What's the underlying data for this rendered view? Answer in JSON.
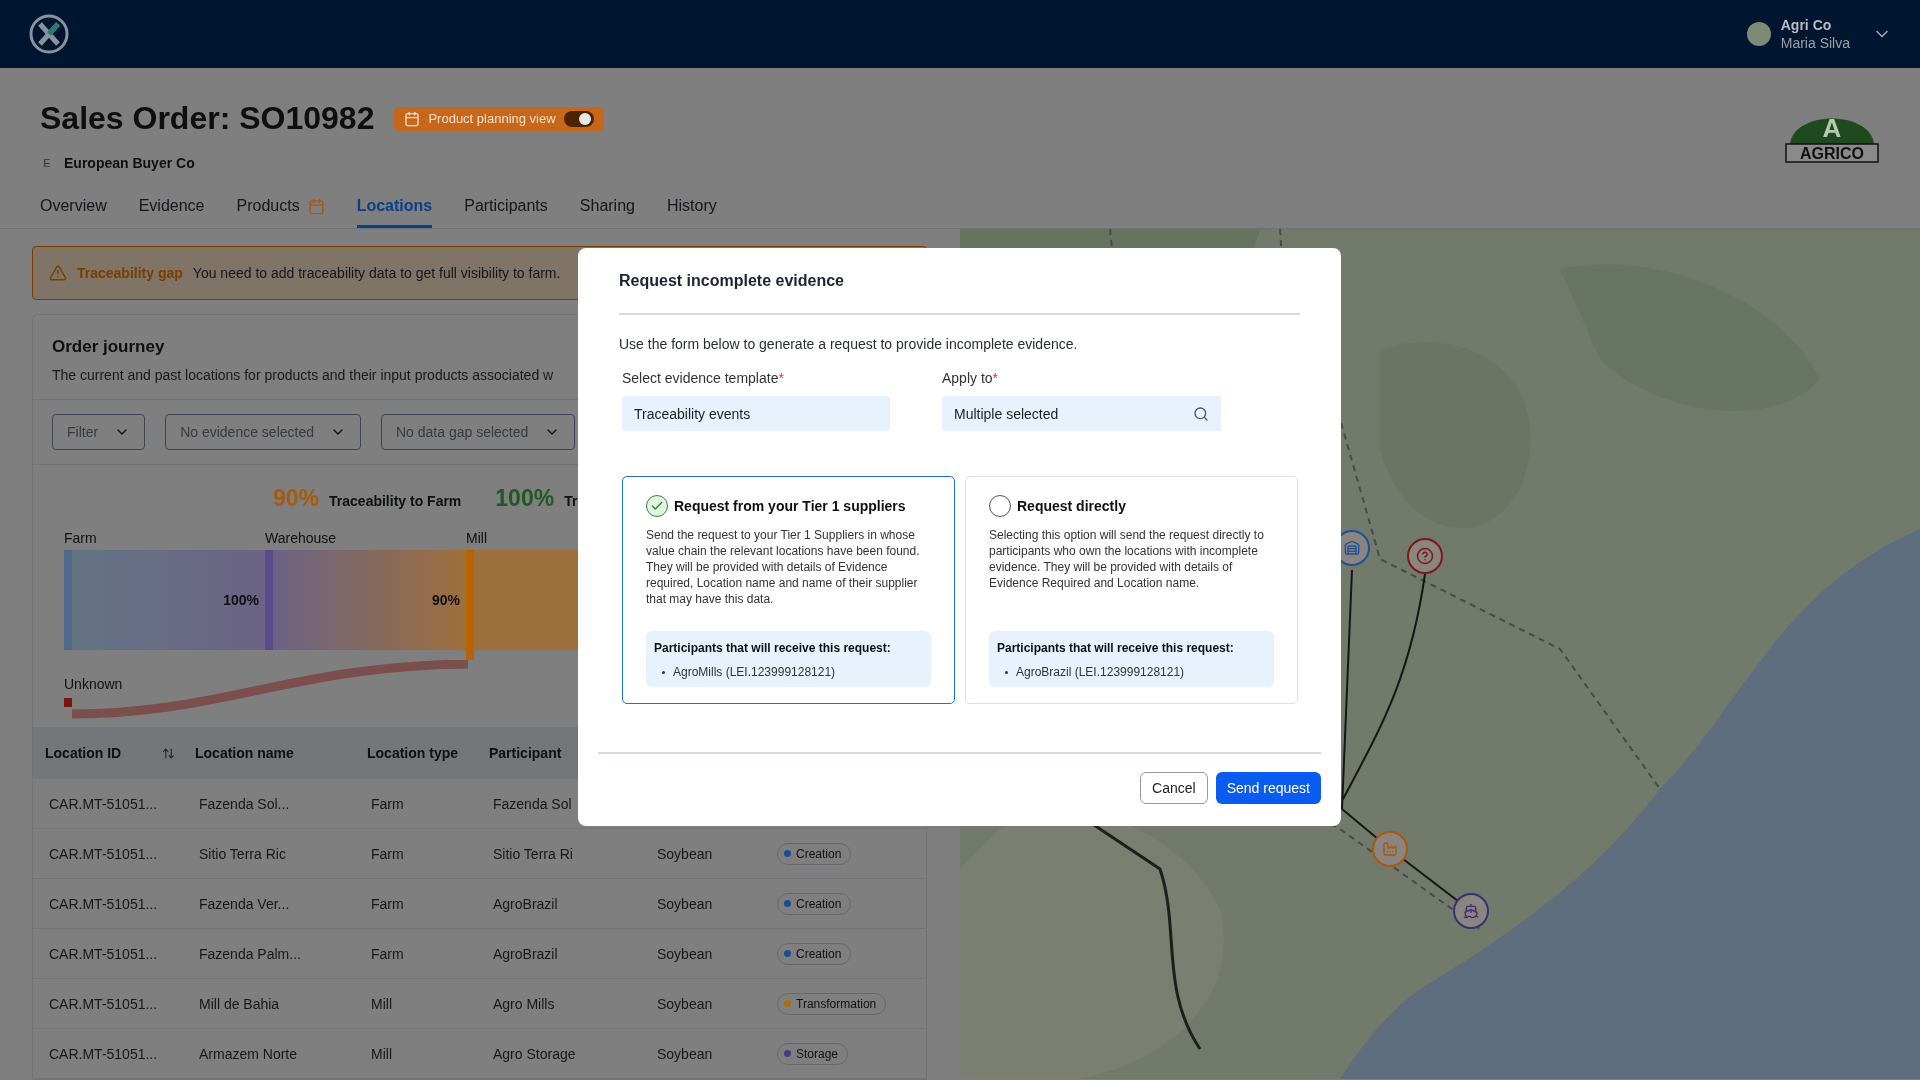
{
  "app_header": {
    "account": {
      "org": "Agri Co",
      "user": "Maria Silva"
    }
  },
  "page": {
    "title": "Sales Order: SO10982",
    "planning_toggle": {
      "label": "Product planning view",
      "on": true
    },
    "buyer": {
      "initial": "E",
      "name": "European Buyer Co"
    },
    "brand_logo": {
      "letter": "A",
      "word": "AGRICO"
    }
  },
  "tabs": [
    {
      "label": "Overview",
      "selected": false,
      "planning_icon": false
    },
    {
      "label": "Evidence",
      "selected": false,
      "planning_icon": false
    },
    {
      "label": "Products",
      "selected": false,
      "planning_icon": true
    },
    {
      "label": "Locations",
      "selected": true,
      "planning_icon": false
    },
    {
      "label": "Participants",
      "selected": false,
      "planning_icon": false
    },
    {
      "label": "Sharing",
      "selected": false,
      "planning_icon": false
    },
    {
      "label": "History",
      "selected": false,
      "planning_icon": false
    }
  ],
  "alert": {
    "title": "Traceability gap",
    "message": "You need to add traceability data to get full visibility to farm."
  },
  "order_journey": {
    "title": "Order journey",
    "description": "The current and past locations for products and their input products associated w",
    "filters": [
      {
        "label": "Filter"
      },
      {
        "label": "No evidence selected"
      },
      {
        "label": "No data gap selected"
      }
    ],
    "metrics": [
      {
        "value": "90%",
        "label": "Traceability to Farm",
        "color": "#a55a0c"
      },
      {
        "value": "100%",
        "label": "Tr",
        "color": "#1f5a22"
      }
    ],
    "flow": {
      "stages": [
        {
          "label": "Farm",
          "color": "#4e6a8a",
          "flow_label": "100%"
        },
        {
          "label": "Warehouse",
          "color": "#5a4a8a",
          "flow_label": "90%"
        },
        {
          "label": "Mill",
          "color": "#b86200"
        }
      ],
      "unknown": {
        "label": "Unknown",
        "color": "#7a1410"
      }
    }
  },
  "table": {
    "columns": [
      "Location ID",
      "Location name",
      "Location type",
      "Participant"
    ],
    "rows": [
      {
        "id": "CAR.MT-51051...",
        "name": "Fazenda Sol...",
        "type": "Farm",
        "participant": "Fazenda Sol"
      },
      {
        "id": "CAR.MT-51051...",
        "name": "Sitio Terra Ric",
        "type": "Farm",
        "participant": "Sitio Terra Ri",
        "product": "Soybean",
        "event": {
          "label": "Creation",
          "color": "#1a4f8f"
        }
      },
      {
        "id": "CAR.MT-51051...",
        "name": "Fazenda Ver...",
        "type": "Farm",
        "participant": "AgroBrazil",
        "product": "Soybean",
        "event": {
          "label": "Creation",
          "color": "#1a4f8f"
        }
      },
      {
        "id": "CAR.MT-51051...",
        "name": "Fazenda Palm...",
        "type": "Farm",
        "participant": "AgroBrazil",
        "product": "Soybean",
        "event": {
          "label": "Creation",
          "color": "#1a4f8f"
        }
      },
      {
        "id": "CAR.MT-51051...",
        "name": "Mill de Bahia",
        "type": "Mill",
        "participant": "Agro Mills",
        "product": "Soybean",
        "event": {
          "label": "Transformation",
          "color": "#b06a10"
        }
      },
      {
        "id": "CAR.MT-51051...",
        "name": "Armazem Norte",
        "type": "Mill",
        "participant": "Agro Storage",
        "product": "Soybean",
        "event": {
          "label": "Storage",
          "color": "#4a3a80"
        }
      }
    ]
  },
  "modal": {
    "title": "Request incomplete evidence",
    "intro": "Use the form below to generate a request to provide incomplete evidence.",
    "fields": [
      {
        "label": "Select evidence template",
        "required_mark": "*",
        "value": "Traceability events",
        "kind": "select"
      },
      {
        "label": "Apply to",
        "required_mark": "*",
        "value": "Multiple selected",
        "kind": "search"
      }
    ],
    "options": [
      {
        "title": "Request from your Tier 1 suppliers",
        "selected": true,
        "description": "Send the request to your Tier 1 Suppliers in whose value chain the relevant locations have been found. They will be provided with details of Evidence required, Location name and name of their supplier that may have this data.",
        "recipients_title": "Participants that will receive this request:",
        "recipients": [
          "AgroMills (LEI.123999128121)"
        ]
      },
      {
        "title": "Request directly",
        "selected": false,
        "description": "Selecting this option will send the request directly to participants who own the locations with incomplete evidence. They will be provided with details of Evidence Required and Location name.",
        "recipients_title": "Participants that will receive this request:",
        "recipients": [
          "AgroBrazil (LEI.123999128121)"
        ]
      }
    ],
    "buttons": [
      {
        "label": "Cancel",
        "kind": "secondary"
      },
      {
        "label": "Send request",
        "kind": "primary"
      }
    ]
  }
}
